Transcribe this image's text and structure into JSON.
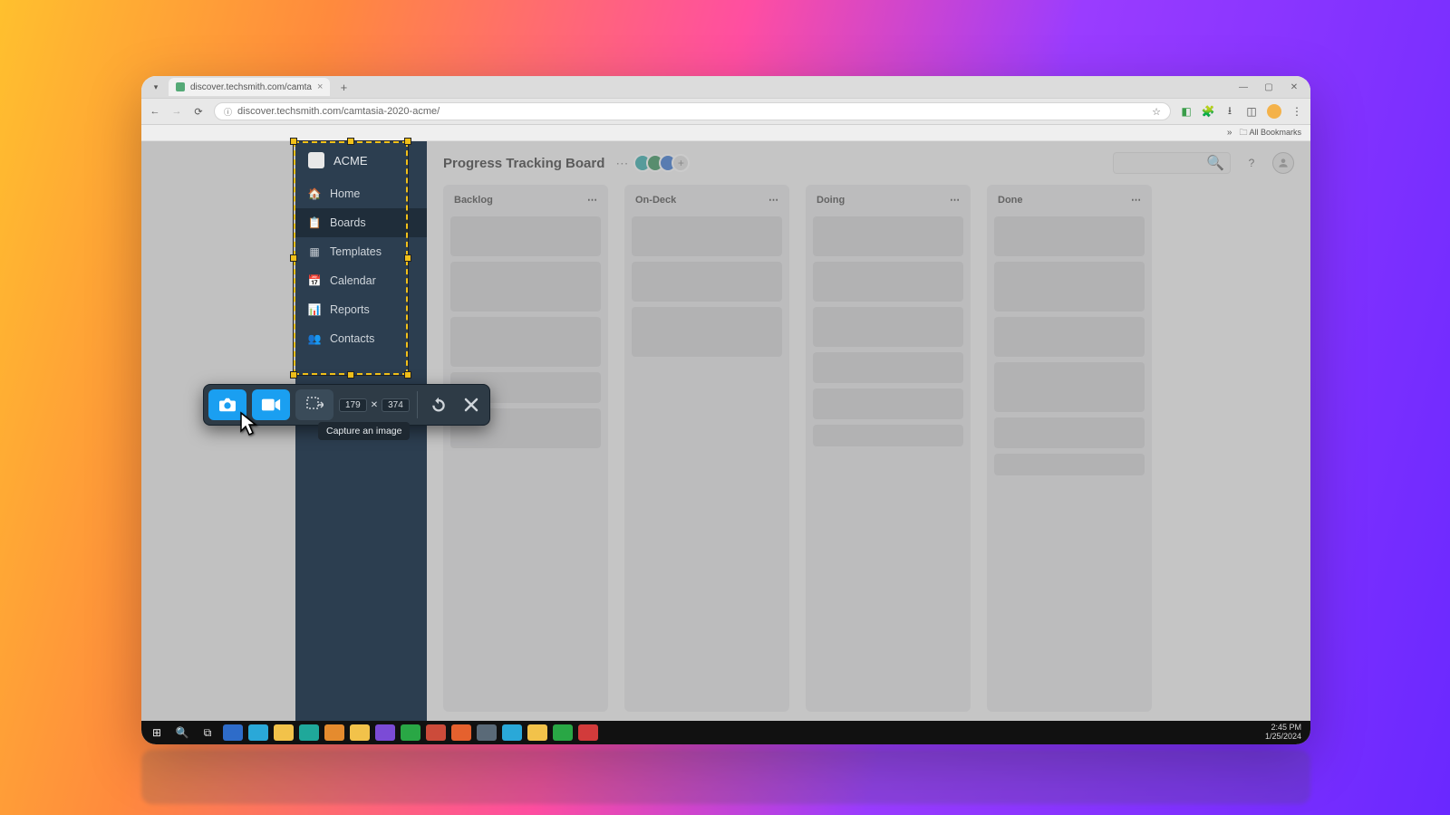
{
  "browser": {
    "tab_title": "discover.techsmith.com/camta",
    "url": "discover.techsmith.com/camtasia-2020-acme/",
    "bookmarks_label": "All Bookmarks"
  },
  "sidebar": {
    "workspace": "ACME",
    "items": [
      {
        "label": "Home",
        "icon": "home-icon"
      },
      {
        "label": "Boards",
        "icon": "clipboard-icon"
      },
      {
        "label": "Templates",
        "icon": "grid-icon"
      },
      {
        "label": "Calendar",
        "icon": "calendar-icon"
      },
      {
        "label": "Reports",
        "icon": "chart-icon"
      },
      {
        "label": "Contacts",
        "icon": "users-icon"
      }
    ]
  },
  "board": {
    "title": "Progress Tracking Board",
    "columns": [
      "Backlog",
      "On-Deck",
      "Doing",
      "Done"
    ]
  },
  "capture": {
    "width": "179",
    "height": "374",
    "tooltip": "Capture an image"
  },
  "taskbar": {
    "time": "2:45 PM",
    "date": "1/25/2024"
  }
}
